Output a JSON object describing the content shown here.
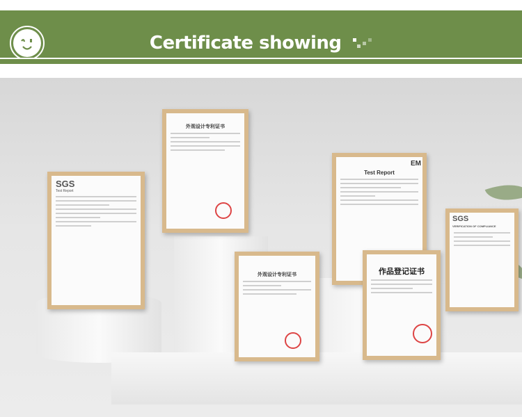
{
  "header": {
    "title": "Certificate showing",
    "icon": "smiley-icon",
    "accent": "#6e8e4a"
  },
  "certificates": [
    {
      "brand": "SGS",
      "subtitle": "Test Report"
    },
    {
      "title": "外观设计专利证书"
    },
    {
      "title": "外观设计专利证书"
    },
    {
      "title": "Test Report",
      "brand": "EM"
    },
    {
      "title": "作品登记证书"
    },
    {
      "brand": "SGS",
      "subtitle": "VERIFICATION OF COMPLIANCE"
    }
  ]
}
